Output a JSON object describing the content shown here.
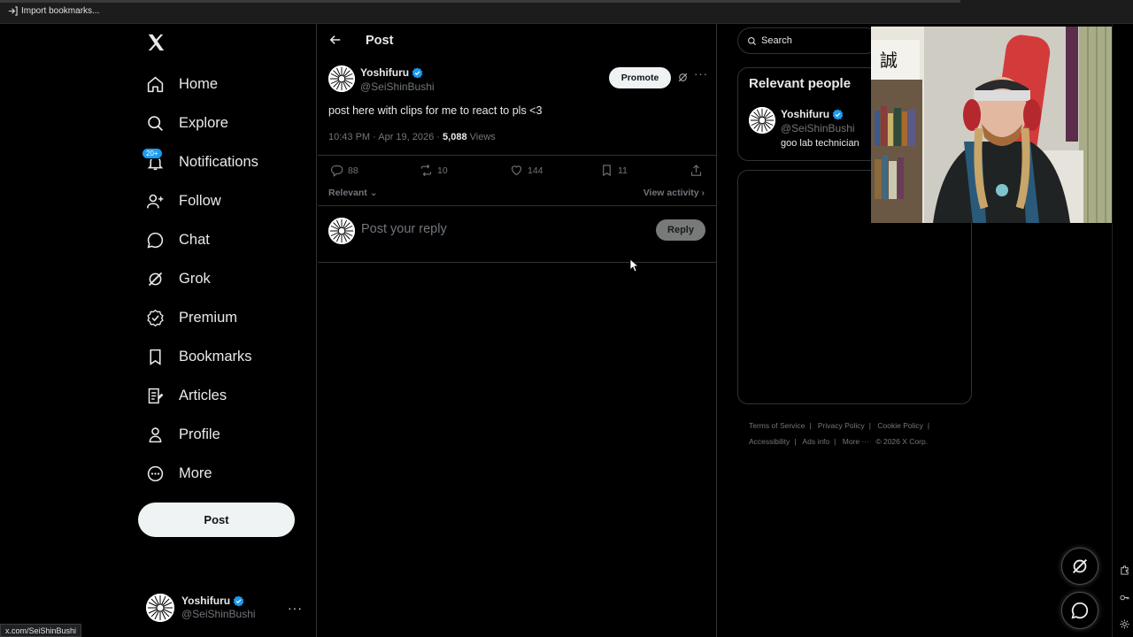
{
  "browser": {
    "bookmark_label": "Import bookmarks...",
    "status_url": "x.com/SeiShinBushi"
  },
  "nav": {
    "items": [
      {
        "label": "Home",
        "icon": "home-icon"
      },
      {
        "label": "Explore",
        "icon": "search-icon"
      },
      {
        "label": "Notifications",
        "icon": "bell-icon",
        "badge": "20+"
      },
      {
        "label": "Follow",
        "icon": "add-person-icon"
      },
      {
        "label": "Chat",
        "icon": "chat-bubble-icon"
      },
      {
        "label": "Grok",
        "icon": "grok-icon"
      },
      {
        "label": "Premium",
        "icon": "verified-badge-icon"
      },
      {
        "label": "Bookmarks",
        "icon": "bookmark-icon"
      },
      {
        "label": "Articles",
        "icon": "article-icon"
      },
      {
        "label": "Profile",
        "icon": "person-icon"
      },
      {
        "label": "More",
        "icon": "more-circle-icon"
      }
    ],
    "post_button": "Post",
    "account": {
      "name": "Yoshifuru",
      "handle": "@SeiShinBushi"
    }
  },
  "main": {
    "header_title": "Post",
    "post": {
      "author_name": "Yoshifuru",
      "author_handle": "@SeiShinBushi",
      "promote_label": "Promote",
      "text": "post here with clips for me to react to pls <3",
      "timestamp": "10:43 PM · Apr 19, 2026 · ",
      "views_count": "5,088",
      "views_label": " Views",
      "replies": "88",
      "reposts": "10",
      "likes": "144",
      "bookmarks": "11"
    },
    "sort_label": "Relevant",
    "view_activity": "View activity",
    "reply_placeholder": "Post your reply",
    "reply_button": "Reply"
  },
  "right": {
    "search_label": "Search",
    "relevant_title": "Relevant people",
    "person": {
      "name": "Yoshifuru",
      "handle": "@SeiShinBushi",
      "bio": "goo lab technician"
    },
    "footer": [
      "Terms of Service",
      "Privacy Policy",
      "Cookie Policy",
      "Accessibility",
      "Ads info",
      "More ···",
      "© 2026 X Corp."
    ]
  },
  "colors": {
    "accent": "#1d9bf0",
    "background": "#000000",
    "text": "#e7e9ea",
    "muted": "#71767b",
    "border": "#2f3336"
  }
}
